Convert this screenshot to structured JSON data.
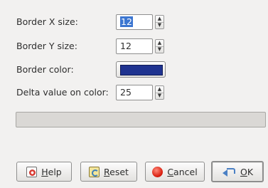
{
  "form": {
    "border_x": {
      "label": "Border X size:",
      "value": "12",
      "up": "▲",
      "down": "▼"
    },
    "border_y": {
      "label": "Border Y size:",
      "value": "12",
      "up": "▲",
      "down": "▼"
    },
    "border_color": {
      "label": "Border color:",
      "color": "#1f3390"
    },
    "delta": {
      "label": "Delta value on color:",
      "value": "25",
      "up": "▲",
      "down": "▼"
    }
  },
  "progress": {
    "fraction": 0
  },
  "buttons": {
    "help": {
      "mnemonic": "H",
      "rest": "elp",
      "icon": "help-icon"
    },
    "reset": {
      "mnemonic": "R",
      "rest": "eset",
      "icon": "reset-icon"
    },
    "cancel": {
      "mnemonic": "C",
      "rest": "ancel",
      "icon": "cancel-icon"
    },
    "ok": {
      "mnemonic": "O",
      "rest": "K",
      "icon": "ok-icon"
    }
  }
}
